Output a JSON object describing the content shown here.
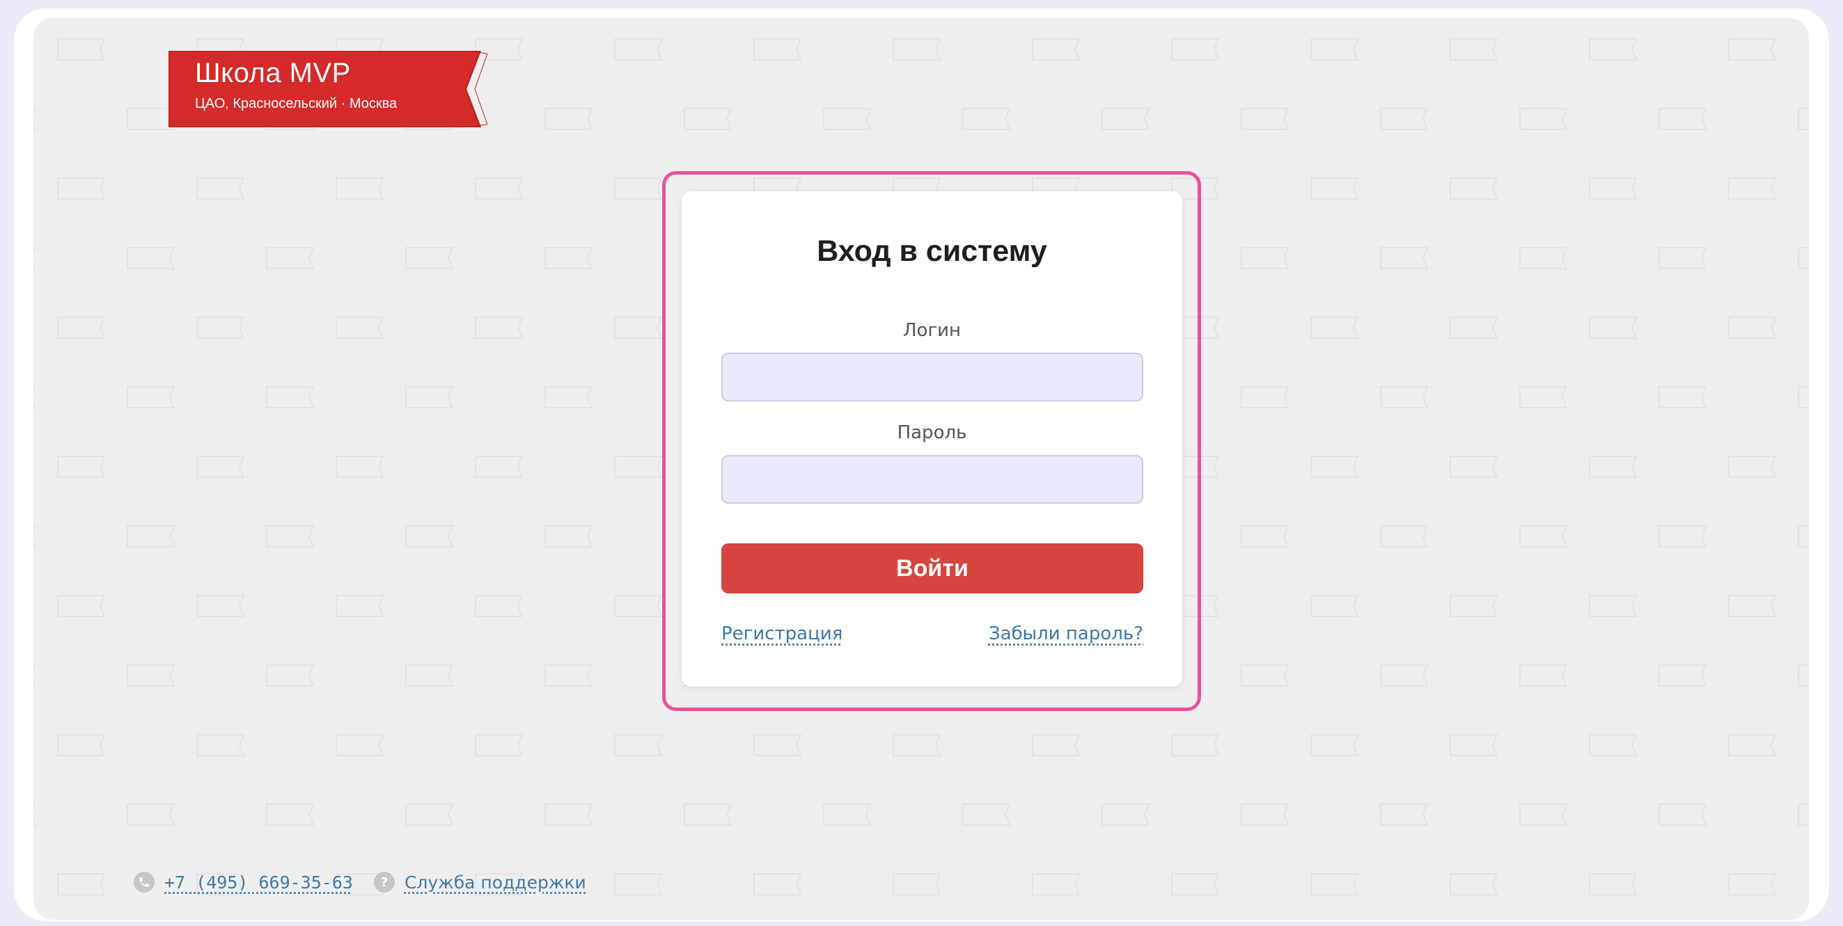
{
  "logo": {
    "title": "Школа MVP",
    "subtitle": "ЦАО, Красносельский · Москва"
  },
  "login_form": {
    "title": "Вход в систему",
    "login_label": "Логин",
    "login_value": "",
    "password_label": "Пароль",
    "password_value": "",
    "submit_label": "Войти",
    "register_link": "Регистрация",
    "forgot_link": "Забыли пароль?"
  },
  "footer": {
    "phone_icon": "phone-icon",
    "phone": "+7 (495) 669-35-63",
    "help_icon": "help-icon",
    "support_link": "Служба поддержки"
  },
  "colors": {
    "brand_red": "#d6453f",
    "logo_red": "#d42a2a",
    "highlight_pink": "#e8529b",
    "link_blue": "#3e79a8",
    "input_bg": "#e8ecfe",
    "page_bg": "#efefef"
  }
}
